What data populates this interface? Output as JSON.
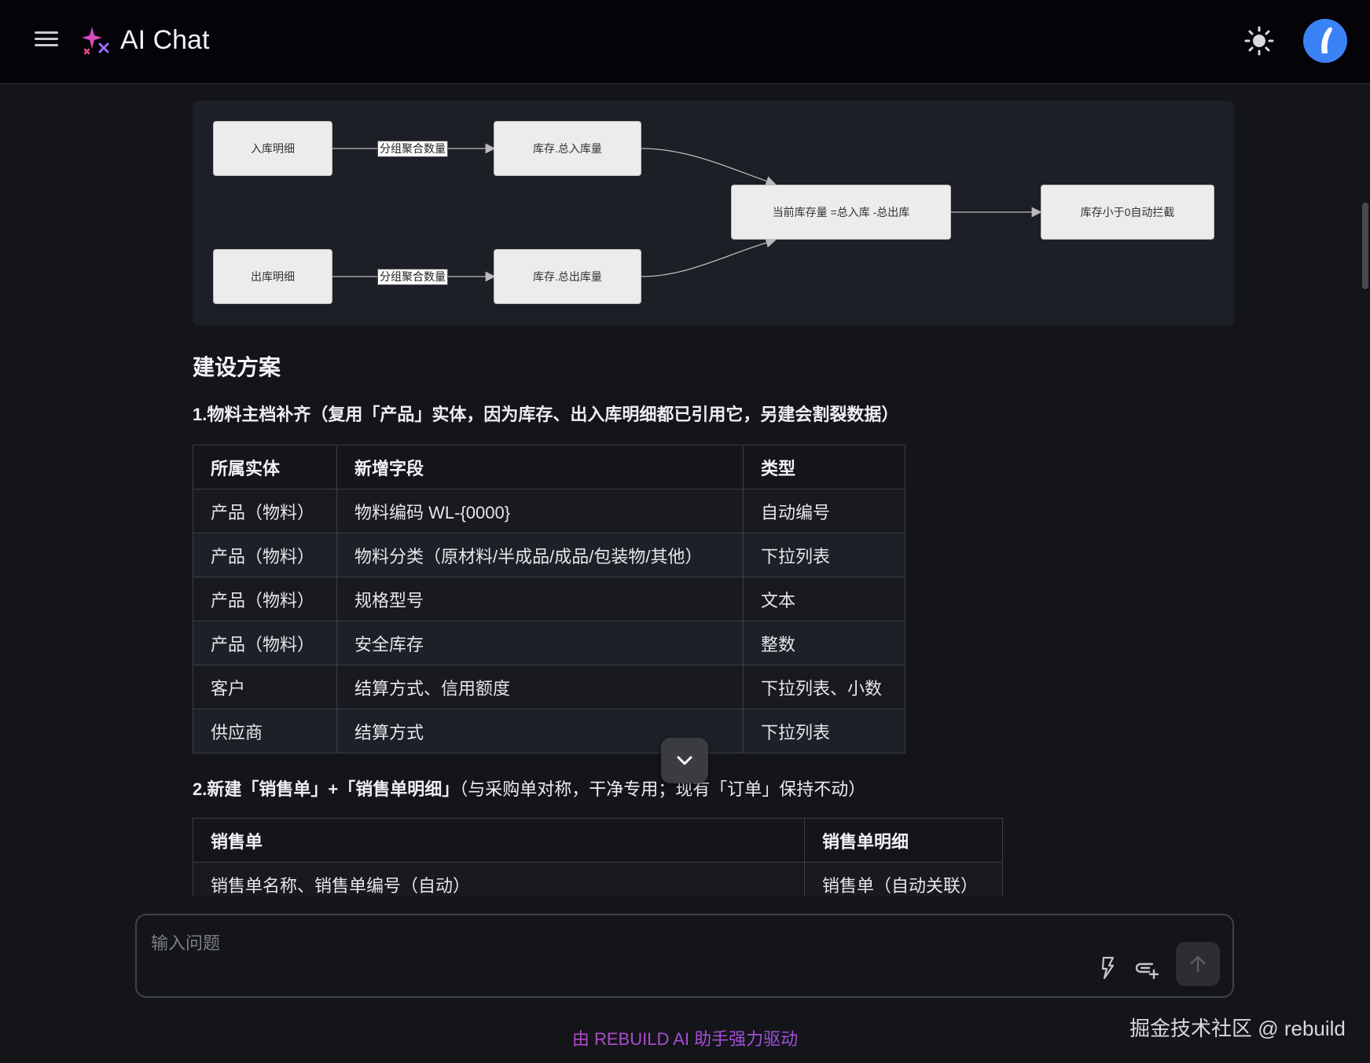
{
  "header": {
    "title": "AI Chat",
    "menu_icon": "hamburger-menu-icon",
    "logo_icon": "sparkle-logo-icon",
    "theme_icon": "sun-icon",
    "avatar_color": "#3b82f6"
  },
  "diagram": {
    "nodes": {
      "inbound_detail": "入库明细",
      "outbound_detail": "出库明细",
      "total_in": "库存.总入库量",
      "total_out": "库存.总出库量",
      "current_stock": "当前库存量 =总入库 -总出库",
      "block": "库存小于0自动拦截"
    },
    "edge_labels": {
      "group_sum_in": "分组聚合数量",
      "group_sum_out": "分组聚合数量"
    }
  },
  "article": {
    "section_title": "建设方案",
    "sub1": "1.物料主档补齐（复用「产品」实体，因为库存、出入库明细都已引用它，另建会割裂数据）",
    "table1": {
      "headers": [
        "所属实体",
        "新增字段",
        "类型"
      ],
      "rows": [
        [
          "产品（物料）",
          "物料编码 WL-{0000}",
          "自动编号"
        ],
        [
          "产品（物料）",
          "物料分类（原材料/半成品/成品/包装物/其他）",
          "下拉列表"
        ],
        [
          "产品（物料）",
          "规格型号",
          "文本"
        ],
        [
          "产品（物料）",
          "安全库存",
          "整数"
        ],
        [
          "客户",
          "结算方式、信用额度",
          "下拉列表、小数"
        ],
        [
          "供应商",
          "结算方式",
          "下拉列表"
        ]
      ]
    },
    "sub2_bold": "2.新建「销售单」+「销售单明细」",
    "sub2_rest": "（与采购单对称，干净专用；现有「订单」保持不动）",
    "table2": {
      "headers": [
        "销售单",
        "销售单明细"
      ],
      "rows": [
        [
          "销售单名称、销售单编号（自动）",
          "销售单（自动关联）"
        ]
      ]
    }
  },
  "input": {
    "placeholder": "输入问题",
    "icons": [
      "lightning-icon",
      "attach-icon",
      "send-arrow-icon"
    ]
  },
  "footer": {
    "powered_by": "由 REBUILD AI 助手强力驱动",
    "watermark": "掘金技术社区 @ rebuild"
  },
  "colors": {
    "background": "#141519",
    "header": "#030308",
    "accent": "#3b82f6"
  }
}
